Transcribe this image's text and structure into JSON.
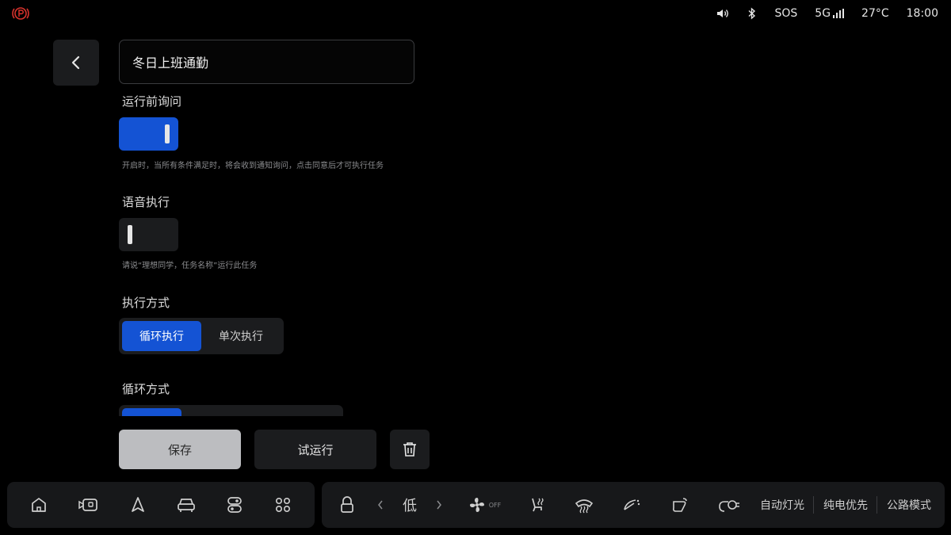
{
  "status_bar": {
    "sos": "SOS",
    "network": "5G",
    "temperature": "27°C",
    "time": "18:00",
    "icons": [
      "parking-brake-icon",
      "volume-icon",
      "bluetooth-icon",
      "signal-icon"
    ]
  },
  "header": {
    "task_name_value": "冬日上班通勤"
  },
  "ask_before_run": {
    "title": "运行前询问",
    "enabled": true,
    "hint": "开启时，当所有条件满足时，将会收到通知询问，点击同意后才可执行任务"
  },
  "voice_execute": {
    "title": "语音执行",
    "enabled": false,
    "hint": "请说“理想同学，任务名称”运行此任务"
  },
  "execution_mode": {
    "title": "执行方式",
    "options": [
      "循环执行",
      "单次执行"
    ],
    "selected": "循环执行"
  },
  "loop_mode": {
    "title": "循环方式"
  },
  "actions": {
    "save_label": "保存",
    "test_run_label": "试运行"
  },
  "dock": {
    "fan_speed_label": "低",
    "fan_state": "OFF",
    "auto_lights": "自动灯光",
    "ev_priority": "纯电优先",
    "road_mode": "公路模式"
  },
  "colors": {
    "accent": "#1453d4",
    "background": "#000000",
    "panel": "#1b1c1e",
    "parking_red": "#d8322c"
  }
}
